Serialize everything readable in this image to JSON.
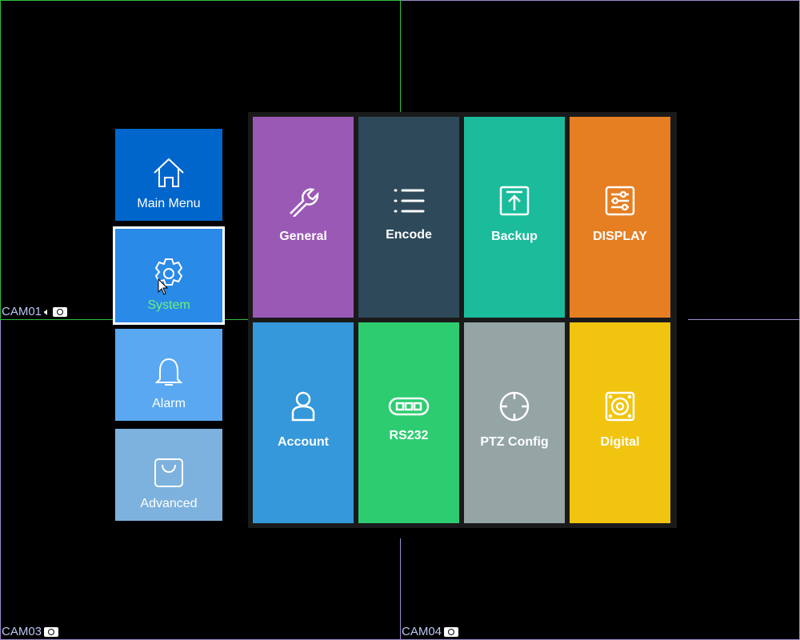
{
  "cameras": [
    {
      "label": "CAM01"
    },
    {
      "label": "CAM03"
    },
    {
      "label": "CAM04"
    }
  ],
  "sidebar": {
    "items": [
      {
        "label": "Main Menu",
        "icon": "home-icon",
        "color": "#0066cc"
      },
      {
        "label": "System",
        "icon": "gear-icon",
        "color": "#2a8ae8",
        "selected": true,
        "label_color": "#6ef07a"
      },
      {
        "label": "Alarm",
        "icon": "bell-icon",
        "color": "#5aa8f2"
      },
      {
        "label": "Advanced",
        "icon": "bag-icon",
        "color": "#7db2de"
      }
    ]
  },
  "tiles": [
    {
      "label": "General",
      "icon": "wrench-icon",
      "color": "#9b59b6"
    },
    {
      "label": "Encode",
      "icon": "list-icon",
      "color": "#2e4a5a"
    },
    {
      "label": "Backup",
      "icon": "upload-icon",
      "color": "#1abc9c"
    },
    {
      "label": "DISPLAY",
      "icon": "sliders-icon",
      "color": "#e67e22"
    },
    {
      "label": "Account",
      "icon": "user-icon",
      "color": "#3498db"
    },
    {
      "label": "RS232",
      "icon": "serial-port-icon",
      "color": "#2ecc71"
    },
    {
      "label": "PTZ Config",
      "icon": "crosshair-icon",
      "color": "#95a5a6"
    },
    {
      "label": "Digital",
      "icon": "speaker-icon",
      "color": "#f1c40f"
    }
  ]
}
